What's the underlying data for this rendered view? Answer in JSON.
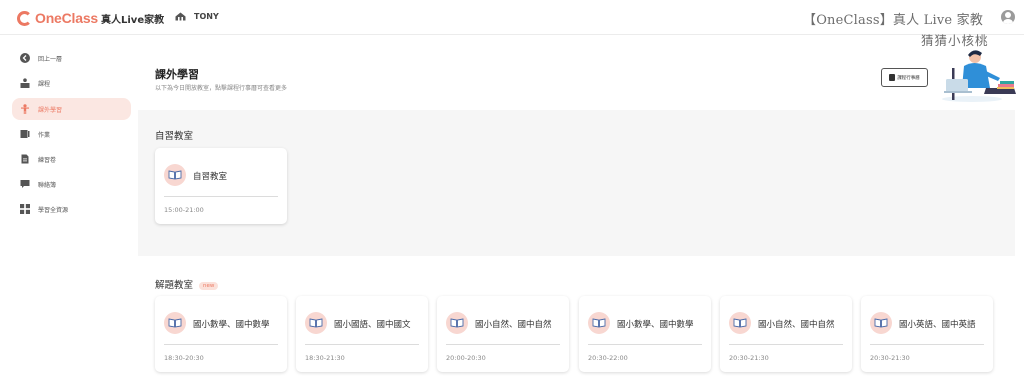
{
  "header": {
    "logo_text": "OneClass",
    "logo_sub": "真人Live家教",
    "user_name": "TONY",
    "watermark_line1": "【OneClass】真人 Live 家教",
    "watermark_line2": "猜猜小核桃"
  },
  "sidebar": {
    "items": [
      {
        "label": "回上一層",
        "icon": "arrow-left-circle-icon",
        "active": false
      },
      {
        "label": "課程",
        "icon": "teacher-desk-icon",
        "active": false
      },
      {
        "label": "課外學習",
        "icon": "person-icon",
        "active": true
      },
      {
        "label": "作業",
        "icon": "homework-icon",
        "active": false
      },
      {
        "label": "練習卷",
        "icon": "document-icon",
        "active": false
      },
      {
        "label": "聯絡簿",
        "icon": "chat-bubble-icon",
        "active": false
      },
      {
        "label": "學習全資源",
        "icon": "grid-icon",
        "active": false
      }
    ]
  },
  "main": {
    "title": "課外學習",
    "subtitle": "以下為今日開放教室，點擊課程行事曆可查看更多",
    "schedule_button": "課程行事曆",
    "self_study": {
      "title": "自習教室",
      "cards": [
        {
          "title": "自習教室",
          "time": "15:00-21:00"
        }
      ]
    },
    "qa": {
      "title": "解題教室",
      "tag": "new",
      "cards": [
        {
          "title": "國小數學、國中數學",
          "time": "18:30-20:30"
        },
        {
          "title": "國小國語、國中國文",
          "time": "18:30-21:30"
        },
        {
          "title": "國小自然、國中自然",
          "time": "20:00-20:30"
        },
        {
          "title": "國小數學、國中數學",
          "time": "20:30-22:00"
        },
        {
          "title": "國小自然、國中自然",
          "time": "20:30-21:30"
        },
        {
          "title": "國小英語、國中英語",
          "time": "20:30-21:30"
        }
      ]
    }
  },
  "colors": {
    "brand": "#ec7963",
    "active_bg": "#fbe7e2",
    "panel_bg": "#f6f6f6",
    "badge_bg": "#f8d7d1"
  }
}
